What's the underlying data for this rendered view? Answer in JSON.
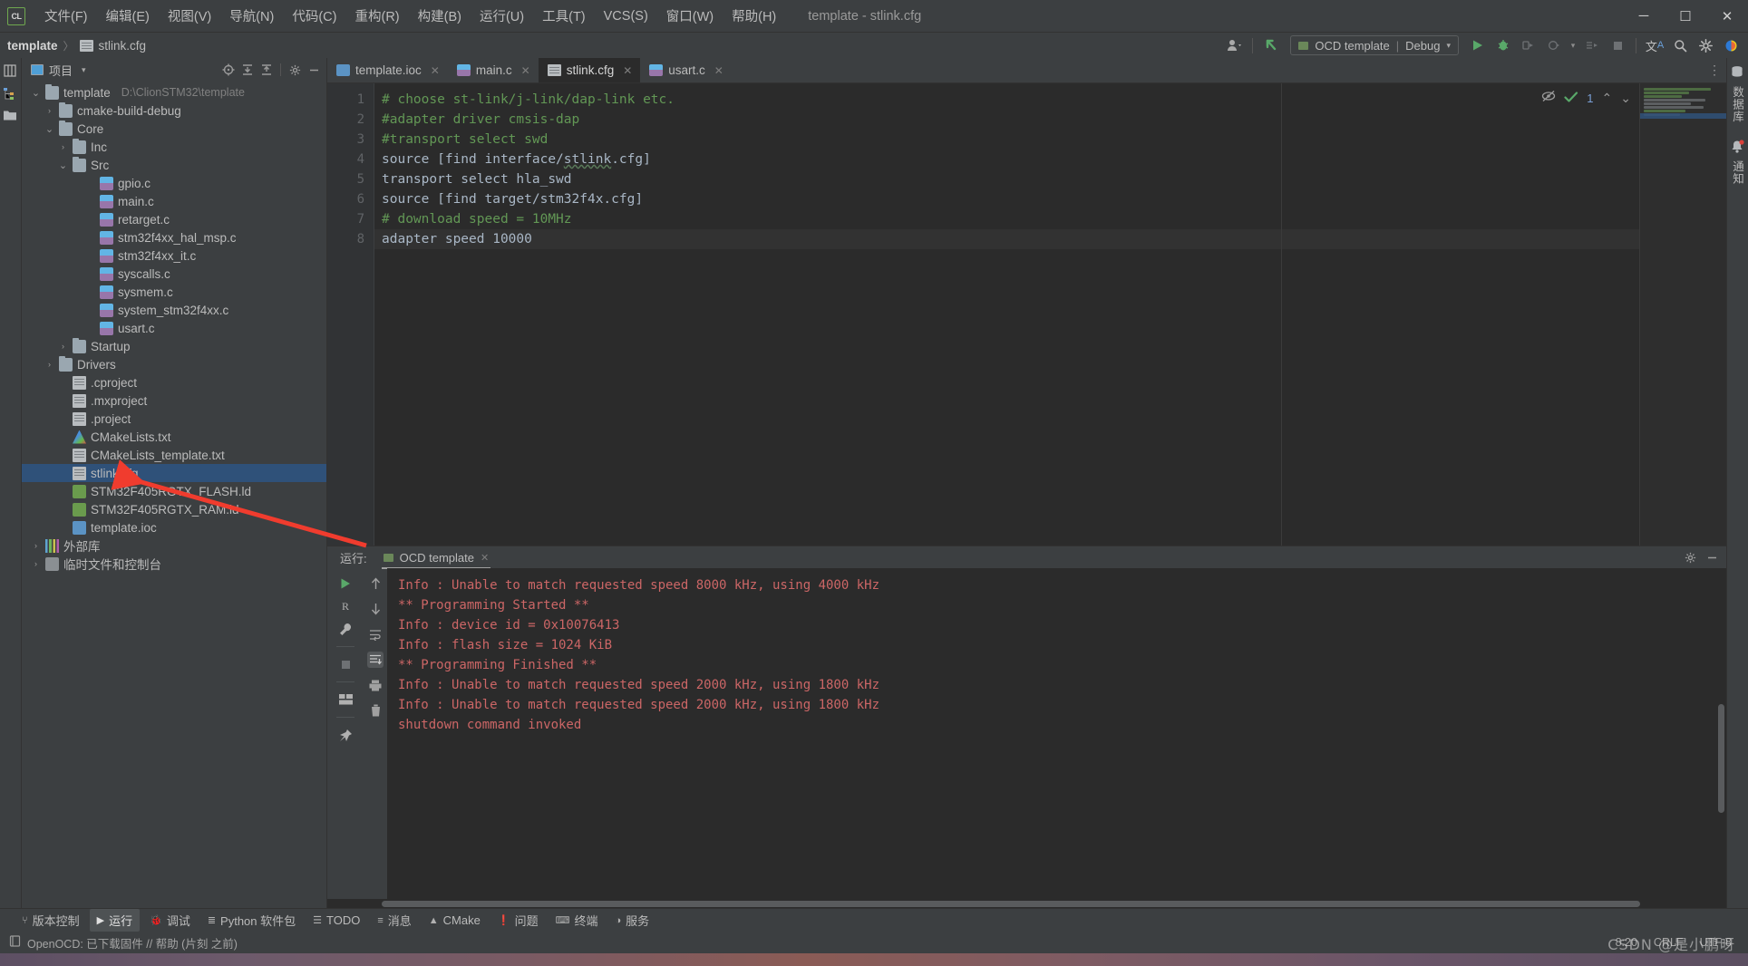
{
  "window": {
    "title": "template - stlink.cfg",
    "logo": "clion-logo",
    "controls": {
      "minimize": "─",
      "maximize": "☐",
      "close": "✕"
    }
  },
  "menubar": {
    "items": [
      {
        "label": "文件(F)",
        "name": "menu-file"
      },
      {
        "label": "编辑(E)",
        "name": "menu-edit"
      },
      {
        "label": "视图(V)",
        "name": "menu-view"
      },
      {
        "label": "导航(N)",
        "name": "menu-navigate"
      },
      {
        "label": "代码(C)",
        "name": "menu-code"
      },
      {
        "label": "重构(R)",
        "name": "menu-refactor"
      },
      {
        "label": "构建(B)",
        "name": "menu-build"
      },
      {
        "label": "运行(U)",
        "name": "menu-run"
      },
      {
        "label": "工具(T)",
        "name": "menu-tools"
      },
      {
        "label": "VCS(S)",
        "name": "menu-vcs"
      },
      {
        "label": "窗口(W)",
        "name": "menu-window"
      },
      {
        "label": "帮助(H)",
        "name": "menu-help"
      }
    ]
  },
  "breadcrumb": {
    "project": "template",
    "separator": "〉",
    "file": "stlink.cfg"
  },
  "toolbar": {
    "run_config": {
      "label": "OCD template",
      "divider": "|",
      "mode": "Debug",
      "caret": "▾",
      "accent": "#6a8759"
    },
    "icons": [
      {
        "name": "user-avatar-icon",
        "glyph": "👤"
      },
      {
        "name": "updates-arrow-icon",
        "glyph": "↖",
        "color": "#59a869"
      },
      {
        "name": "run-icon",
        "glyph": "▶",
        "color": "#59a869"
      },
      {
        "name": "debug-icon",
        "glyph": "bug",
        "color": "#59a869"
      },
      {
        "name": "run-with-coverage-icon",
        "glyph": "▷"
      },
      {
        "name": "profile-icon",
        "glyph": "◴"
      },
      {
        "name": "attach-process-icon",
        "glyph": "▷"
      },
      {
        "name": "stop-icon",
        "glyph": "■"
      },
      {
        "name": "translate-icon",
        "glyph": "文A",
        "color": "#6a9fd8"
      },
      {
        "name": "search-everywhere-icon",
        "glyph": "⌕"
      },
      {
        "name": "settings-gear-icon",
        "glyph": "⚙"
      },
      {
        "name": "ai-assistant-icon",
        "glyph": "◕"
      }
    ]
  },
  "left_strip": [
    {
      "name": "strip-project-icon",
      "label": "项目"
    },
    {
      "name": "strip-structure-icon",
      "label": "结构"
    },
    {
      "name": "strip-bookmarks-icon",
      "label": "书签"
    }
  ],
  "project_panel": {
    "title": "项目",
    "caret": "▾",
    "tools": [
      {
        "name": "select-opened-file-icon",
        "glyph": "⊕"
      },
      {
        "name": "expand-all-icon",
        "glyph": "⤓"
      },
      {
        "name": "collapse-all-icon",
        "glyph": "⤒"
      },
      {
        "name": "panel-settings-icon",
        "glyph": "⚙"
      },
      {
        "name": "hide-panel-icon",
        "glyph": "─"
      }
    ],
    "tree": [
      {
        "label": "template",
        "path": "D:\\ClionSTM32\\template",
        "indent": 0,
        "arrow": "⌄",
        "icon": "folder",
        "selected": false
      },
      {
        "label": "cmake-build-debug",
        "indent": 1,
        "arrow": "›",
        "icon": "folder",
        "selected": false
      },
      {
        "label": "Core",
        "indent": 1,
        "arrow": "⌄",
        "icon": "folder",
        "selected": false
      },
      {
        "label": "Inc",
        "indent": 2,
        "arrow": "›",
        "icon": "folder",
        "selected": false
      },
      {
        "label": "Src",
        "indent": 2,
        "arrow": "⌄",
        "icon": "folder",
        "selected": false
      },
      {
        "label": "gpio.c",
        "indent": 4,
        "arrow": "",
        "icon": "cfile",
        "selected": false
      },
      {
        "label": "main.c",
        "indent": 4,
        "arrow": "",
        "icon": "cfile",
        "selected": false
      },
      {
        "label": "retarget.c",
        "indent": 4,
        "arrow": "",
        "icon": "cfile",
        "selected": false
      },
      {
        "label": "stm32f4xx_hal_msp.c",
        "indent": 4,
        "arrow": "",
        "icon": "cfile",
        "selected": false
      },
      {
        "label": "stm32f4xx_it.c",
        "indent": 4,
        "arrow": "",
        "icon": "cfile",
        "selected": false
      },
      {
        "label": "syscalls.c",
        "indent": 4,
        "arrow": "",
        "icon": "cfile",
        "selected": false
      },
      {
        "label": "sysmem.c",
        "indent": 4,
        "arrow": "",
        "icon": "cfile",
        "selected": false
      },
      {
        "label": "system_stm32f4xx.c",
        "indent": 4,
        "arrow": "",
        "icon": "cfile",
        "selected": false
      },
      {
        "label": "usart.c",
        "indent": 4,
        "arrow": "",
        "icon": "cfile",
        "selected": false
      },
      {
        "label": "Startup",
        "indent": 2,
        "arrow": "›",
        "icon": "folder",
        "selected": false
      },
      {
        "label": "Drivers",
        "indent": 1,
        "arrow": "›",
        "icon": "folder",
        "selected": false
      },
      {
        "label": ".cproject",
        "indent": 2,
        "arrow": "",
        "icon": "txtfile",
        "selected": false
      },
      {
        "label": ".mxproject",
        "indent": 2,
        "arrow": "",
        "icon": "txtfile",
        "selected": false
      },
      {
        "label": ".project",
        "indent": 2,
        "arrow": "",
        "icon": "txtfile",
        "selected": false
      },
      {
        "label": "CMakeLists.txt",
        "indent": 2,
        "arrow": "",
        "icon": "cmake",
        "selected": false
      },
      {
        "label": "CMakeLists_template.txt",
        "indent": 2,
        "arrow": "",
        "icon": "txtfile",
        "selected": false
      },
      {
        "label": "stlink.cfg",
        "indent": 2,
        "arrow": "",
        "icon": "txtfile",
        "selected": true
      },
      {
        "label": "STM32F405RGTX_FLASH.ld",
        "indent": 2,
        "arrow": "",
        "icon": "ldfile",
        "selected": false
      },
      {
        "label": "STM32F405RGTX_RAM.ld",
        "indent": 2,
        "arrow": "",
        "icon": "ldfile",
        "selected": false
      },
      {
        "label": "template.ioc",
        "indent": 2,
        "arrow": "",
        "icon": "iocfile",
        "selected": false
      },
      {
        "label": "外部库",
        "indent": 0,
        "arrow": "›",
        "icon": "lib",
        "selected": false
      },
      {
        "label": "临时文件和控制台",
        "indent": 0,
        "arrow": "›",
        "icon": "console",
        "selected": false
      }
    ]
  },
  "editor": {
    "tabs": [
      {
        "label": "template.ioc",
        "icon": "iocfile",
        "active": false,
        "close": "✕"
      },
      {
        "label": "main.c",
        "icon": "cfile",
        "active": false,
        "close": "✕"
      },
      {
        "label": "stlink.cfg",
        "icon": "txtfile",
        "active": true,
        "close": "✕"
      },
      {
        "label": "usart.c",
        "icon": "cfile",
        "active": false,
        "close": "✕"
      }
    ],
    "tab_options_icon": "⋮",
    "inspection": {
      "hide_icon": "⊘",
      "check_icon": "✔",
      "count": "1",
      "prev_icon": "⌃",
      "next_icon": "⌄"
    },
    "current_line": 8,
    "lines": [
      {
        "n": 1,
        "text": "# choose st-link/j-link/dap-link etc.",
        "kind": "comment"
      },
      {
        "n": 2,
        "text": "#adapter driver cmsis-dap",
        "kind": "comment"
      },
      {
        "n": 3,
        "text": "#transport select swd",
        "kind": "comment"
      },
      {
        "n": 4,
        "text": "source [find interface/stlink.cfg]",
        "kind": "code",
        "typo": "stlink"
      },
      {
        "n": 5,
        "text": "transport select hla_swd",
        "kind": "code"
      },
      {
        "n": 6,
        "text": "source [find target/stm32f4x.cfg]",
        "kind": "code"
      },
      {
        "n": 7,
        "text": "# download speed = 10MHz",
        "kind": "comment"
      },
      {
        "n": 8,
        "text": "adapter speed 10000",
        "kind": "code"
      }
    ]
  },
  "right_strip": {
    "items": [
      {
        "name": "database-icon",
        "label": "数据库",
        "glyph": "⛃"
      },
      {
        "name": "notifications-icon",
        "label": "通知",
        "glyph": "🔔"
      }
    ]
  },
  "run_panel": {
    "label": "运行:",
    "tab": {
      "label": "OCD template",
      "close": "✕"
    },
    "head_icons": [
      {
        "name": "run-settings-icon",
        "glyph": "⚙"
      },
      {
        "name": "hide-run-panel-icon",
        "glyph": "─"
      }
    ],
    "tools": [
      {
        "name": "rerun-icon",
        "glyph": "▶",
        "color": "#59a869"
      },
      {
        "name": "rerun-failed-icon",
        "glyph": "R"
      },
      {
        "name": "edit-configuration-icon",
        "glyph": "🔧"
      },
      {
        "name": "stop-process-icon",
        "glyph": "■"
      },
      {
        "name": "layout-icon",
        "glyph": "⬚"
      },
      {
        "name": "pin-tab-icon",
        "glyph": "📌"
      }
    ],
    "tools2": [
      {
        "name": "scroll-up-icon",
        "glyph": "↑"
      },
      {
        "name": "scroll-down-icon",
        "glyph": "↓"
      },
      {
        "name": "soft-wrap-icon",
        "glyph": "↵"
      },
      {
        "name": "scroll-to-end-icon",
        "glyph": "↧"
      },
      {
        "name": "print-icon",
        "glyph": "⎙"
      },
      {
        "name": "clear-all-icon",
        "glyph": "🗑"
      }
    ],
    "output": [
      "Info : Unable to match requested speed 8000 kHz, using 4000 kHz",
      "** Programming Started **",
      "Info : device id = 0x10076413",
      "Info : flash size = 1024 KiB",
      "** Programming Finished **",
      "Info : Unable to match requested speed 2000 kHz, using 1800 kHz",
      "Info : Unable to match requested speed 2000 kHz, using 1800 kHz",
      "shutdown command invoked"
    ],
    "output_color": "#cc6666"
  },
  "toolwindow_bar": {
    "items": [
      {
        "label": "版本控制",
        "icon": "branch-icon",
        "glyph": "⑂",
        "active": false
      },
      {
        "label": "运行",
        "icon": "run-icon",
        "glyph": "▶",
        "active": true
      },
      {
        "label": "调试",
        "icon": "debug-icon",
        "glyph": "🐞",
        "active": false
      },
      {
        "label": "Python 软件包",
        "icon": "python-packages-icon",
        "glyph": "≣",
        "active": false
      },
      {
        "label": "TODO",
        "icon": "todo-icon",
        "glyph": "☰",
        "active": false
      },
      {
        "label": "消息",
        "icon": "messages-icon",
        "glyph": "≡",
        "active": false
      },
      {
        "label": "CMake",
        "icon": "cmake-icon",
        "glyph": "▲",
        "active": false
      },
      {
        "label": "问题",
        "icon": "problems-icon",
        "glyph": "❗",
        "active": false
      },
      {
        "label": "终端",
        "icon": "terminal-icon",
        "glyph": "⌨",
        "active": false
      },
      {
        "label": "服务",
        "icon": "services-icon",
        "glyph": "◑",
        "active": false
      }
    ]
  },
  "statusbar": {
    "left_icon": "memory-indicator-icon",
    "message": "OpenOCD: 已下载固件 // 帮助 (片刻 之前)",
    "caret_position": "8:20",
    "line_separator": "CRLF",
    "encoding": "UTF-8",
    "watermark": "CSDN @是小鹏呀"
  }
}
